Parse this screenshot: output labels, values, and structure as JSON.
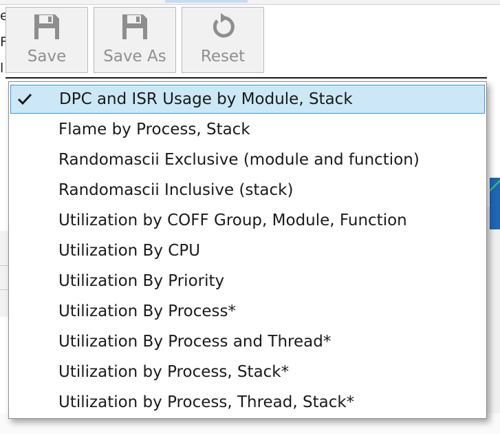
{
  "toolbar": {
    "buttons": [
      {
        "label": "Save",
        "icon": "floppy-disk-icon"
      },
      {
        "label": "Save As",
        "icon": "floppy-disk-icon"
      },
      {
        "label": "Reset",
        "icon": "reset-arrow-icon"
      }
    ]
  },
  "background": {
    "left_fragments": [
      "e",
      "F",
      "l"
    ]
  },
  "menu": {
    "selected_index": 0,
    "items": [
      "DPC and ISR Usage by Module, Stack",
      "Flame by Process, Stack",
      "Randomascii Exclusive (module and function)",
      "Randomascii Inclusive (stack)",
      "Utilization by COFF Group, Module, Function",
      "Utilization By CPU",
      "Utilization By Priority",
      "Utilization By Process*",
      "Utilization By Process and Thread*",
      "Utilization by Process, Stack*",
      "Utilization by Process, Thread, Stack*"
    ]
  },
  "colors": {
    "selection_bg": "#cce8f7",
    "selection_border": "#3a9ad9",
    "disabled_text": "#8f8f8f"
  }
}
